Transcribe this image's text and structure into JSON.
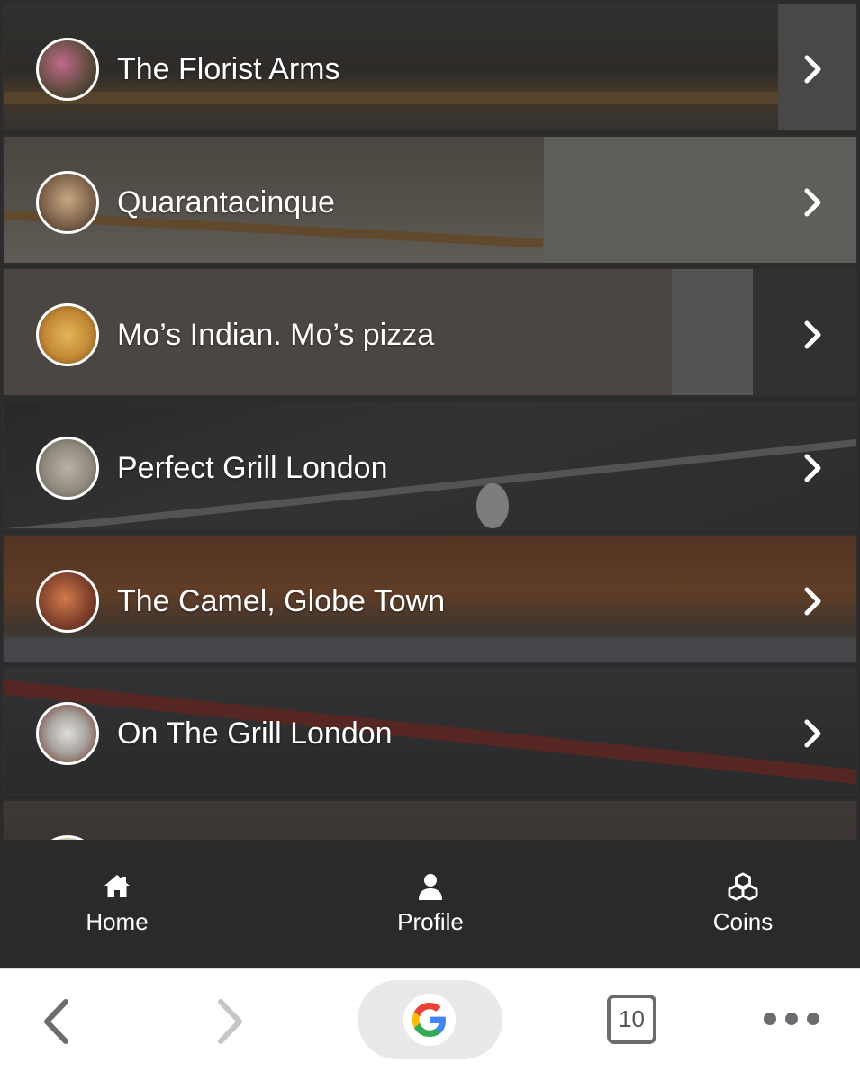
{
  "venues": [
    {
      "name": "The Florist Arms"
    },
    {
      "name": "Quarantacinque"
    },
    {
      "name": "Mo’s Indian. Mo’s pizza"
    },
    {
      "name": "Perfect Grill London"
    },
    {
      "name": "The Camel, Globe Town"
    },
    {
      "name": "On The Grill London"
    },
    {
      "name": ""
    }
  ],
  "tab_bar": {
    "home": {
      "label": "Home",
      "icon": "home-icon"
    },
    "profile": {
      "label": "Profile",
      "icon": "person-icon"
    },
    "coins": {
      "label": "Coins",
      "icon": "cubes-icon"
    }
  },
  "browser": {
    "tab_count": "10",
    "back_icon": "chevron-left-icon",
    "forward_icon": "chevron-right-icon",
    "search_icon": "google-g-icon",
    "more_icon": "ellipsis-icon"
  },
  "colors": {
    "tab_bar_bg": "#2a2a2a",
    "browser_bg": "#ffffff",
    "text_on_dark": "#ffffff"
  }
}
